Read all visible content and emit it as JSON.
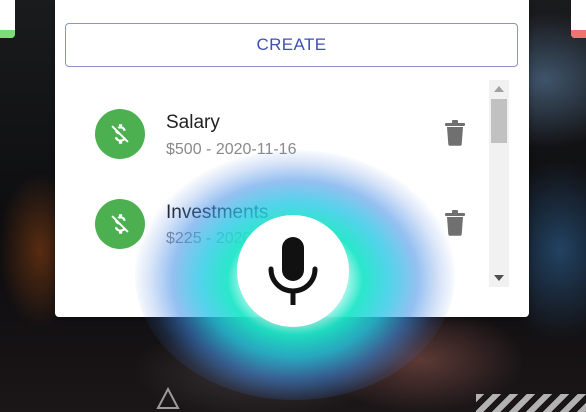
{
  "create_label": "CREATE",
  "transactions": [
    {
      "title": "Salary",
      "subtitle": "$500 - 2020-11-16",
      "icon": "dollar-off-icon",
      "color": "#4caf50"
    },
    {
      "title": "Investments",
      "subtitle": "$225 - 2020-11-16",
      "icon": "dollar-off-icon",
      "color": "#4caf50"
    }
  ],
  "accent": "#3f51b5",
  "income_color": "#4caf50",
  "icons": {
    "delete": "trash-icon",
    "voice": "microphone-icon"
  }
}
